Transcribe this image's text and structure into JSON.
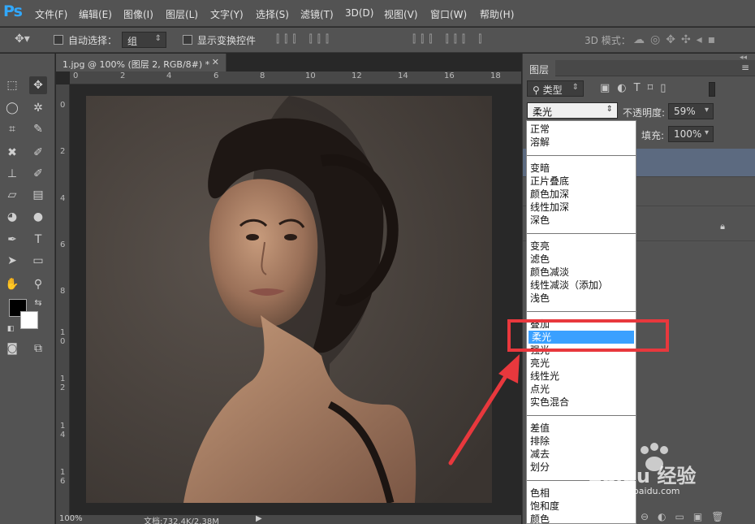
{
  "app": {
    "logo": "Ps"
  },
  "menubar": {
    "items": [
      "文件(F)",
      "编辑(E)",
      "图像(I)",
      "图层(L)",
      "文字(Y)",
      "选择(S)",
      "滤镜(T)",
      "3D(D)",
      "视图(V)",
      "窗口(W)",
      "帮助(H)"
    ]
  },
  "options": {
    "auto_select_label": "自动选择：",
    "auto_select_value": "组",
    "show_transform_label": "显示变换控件",
    "mode_3d_label": "3D 模式："
  },
  "document": {
    "tab_title": "1.jpg @ 100% (图层 2, RGB/8#) *",
    "ruler_top": [
      "0",
      "2",
      "4",
      "6",
      "8",
      "10",
      "12",
      "14",
      "16",
      "18"
    ],
    "ruler_left": [
      "0",
      "2",
      "4",
      "6",
      "8",
      "1\n0",
      "1\n2",
      "1\n4",
      "1\n6"
    ],
    "zoom": "100%",
    "doc_info": "文档:732.4K/2.38M"
  },
  "layers_panel": {
    "tab": "图层",
    "filter_kind": "类型",
    "blend_mode": "柔光",
    "opacity_label": "不透明度:",
    "opacity_value": "59%",
    "fill_label": "填充:",
    "fill_value": "100%"
  },
  "blend_list": {
    "groups": [
      [
        "正常",
        "溶解"
      ],
      [
        "变暗",
        "正片叠底",
        "颜色加深",
        "线性加深",
        "深色"
      ],
      [
        "变亮",
        "滤色",
        "颜色减淡",
        "线性减淡（添加）",
        "浅色"
      ],
      [
        "叠加",
        "柔光",
        "强光",
        "亮光",
        "线性光",
        "点光",
        "实色混合"
      ],
      [
        "差值",
        "排除",
        "减去",
        "划分"
      ],
      [
        "色相",
        "饱和度",
        "颜色"
      ]
    ],
    "selected": "柔光"
  },
  "watermark": {
    "text": "Baidu 经验",
    "sub": "jingyan.baidu.com"
  },
  "colors": {
    "accent": "#31a8ff",
    "selection": "#3aa0ff",
    "annotation": "#e8383d"
  }
}
